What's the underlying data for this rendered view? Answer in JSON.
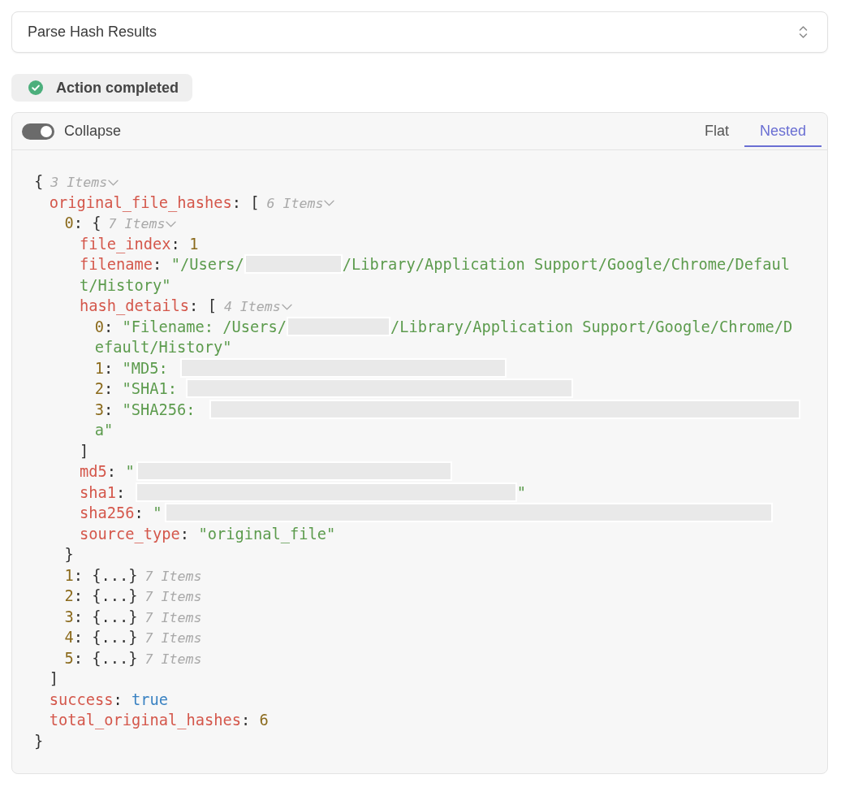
{
  "select": {
    "value": "Parse Hash Results"
  },
  "status": {
    "kind": "success",
    "text": "Action completed"
  },
  "viewer": {
    "collapse": {
      "label": "Collapse",
      "on": true
    },
    "tabs": [
      {
        "label": "Flat",
        "selected": false
      },
      {
        "label": "Nested",
        "selected": true
      }
    ],
    "tree": {
      "kind": "object",
      "open": "{",
      "count": "3 Items",
      "expanded": true,
      "close": "}",
      "children": [
        {
          "key": "original_file_hashes",
          "sep": ":",
          "kind": "array",
          "open": "[",
          "count": "6 Items",
          "expanded": true,
          "close": "]",
          "children": [
            {
              "key": "0",
              "sep": ":",
              "kind": "object",
              "open": "{",
              "count": "7 Items",
              "expanded": true,
              "close": "}",
              "children": [
                {
                  "key": "file_index",
                  "sep": ":",
                  "kind": "number",
                  "value": "1"
                },
                {
                  "key": "filename",
                  "sep": ":",
                  "kind": "string",
                  "parts": [
                    {
                      "kind": "text",
                      "text": "\"/Users/"
                    },
                    {
                      "kind": "redaction"
                    },
                    {
                      "kind": "text",
                      "text": "/Library/Application Support/Google/Chrome/Defaul"
                    },
                    {
                      "kind": "wrap"
                    },
                    {
                      "kind": "text",
                      "text": "t/History\""
                    }
                  ]
                },
                {
                  "key": "hash_details",
                  "sep": ":",
                  "kind": "array",
                  "open": "[",
                  "count": "4 Items",
                  "expanded": true,
                  "close": "]",
                  "children": [
                    {
                      "key": "0",
                      "sep": ":",
                      "kind": "string",
                      "parts": [
                        {
                          "kind": "text",
                          "text": "\"Filename: /Users/"
                        },
                        {
                          "kind": "redaction"
                        },
                        {
                          "kind": "text",
                          "text": "/Library/Application Support/Google/Chrome/D"
                        },
                        {
                          "kind": "wrap"
                        },
                        {
                          "kind": "text",
                          "text": "efault/History\""
                        }
                      ]
                    },
                    {
                      "key": "1",
                      "sep": ":",
                      "kind": "string",
                      "parts": [
                        {
                          "kind": "text",
                          "text": "\"MD5:"
                        },
                        {
                          "kind": "redaction"
                        }
                      ]
                    },
                    {
                      "key": "2",
                      "sep": ":",
                      "kind": "string",
                      "parts": [
                        {
                          "kind": "text",
                          "text": "\"SHA1:"
                        },
                        {
                          "kind": "redaction"
                        }
                      ]
                    },
                    {
                      "key": "3",
                      "sep": ":",
                      "kind": "string",
                      "parts": [
                        {
                          "kind": "text",
                          "text": "\"SHA256:"
                        },
                        {
                          "kind": "redaction"
                        },
                        {
                          "kind": "wrap"
                        },
                        {
                          "kind": "text",
                          "text": "a\""
                        }
                      ]
                    }
                  ]
                },
                {
                  "key": "md5",
                  "sep": ":",
                  "kind": "string",
                  "parts": [
                    {
                      "kind": "text",
                      "text": "\""
                    },
                    {
                      "kind": "redaction"
                    }
                  ]
                },
                {
                  "key": "sha1",
                  "sep": ":",
                  "kind": "string",
                  "parts": [
                    {
                      "kind": "redaction"
                    },
                    {
                      "kind": "text",
                      "text": "\""
                    }
                  ]
                },
                {
                  "key": "sha256",
                  "sep": ":",
                  "kind": "string",
                  "parts": [
                    {
                      "kind": "text",
                      "text": "\""
                    },
                    {
                      "kind": "redaction"
                    }
                  ]
                },
                {
                  "key": "source_type",
                  "sep": ":",
                  "kind": "string",
                  "value": "\"original_file\""
                }
              ]
            },
            {
              "key": "1",
              "sep": ":",
              "kind": "object",
              "summary": "{...}",
              "count": "7 Items",
              "expanded": false
            },
            {
              "key": "2",
              "sep": ":",
              "kind": "object",
              "summary": "{...}",
              "count": "7 Items",
              "expanded": false
            },
            {
              "key": "3",
              "sep": ":",
              "kind": "object",
              "summary": "{...}",
              "count": "7 Items",
              "expanded": false
            },
            {
              "key": "4",
              "sep": ":",
              "kind": "object",
              "summary": "{...}",
              "count": "7 Items",
              "expanded": false
            },
            {
              "key": "5",
              "sep": ":",
              "kind": "object",
              "summary": "{...}",
              "count": "7 Items",
              "expanded": false
            }
          ]
        },
        {
          "key": "success",
          "sep": ":",
          "kind": "boolean",
          "value": "true"
        },
        {
          "key": "total_original_hashes",
          "sep": ":",
          "kind": "number",
          "value": "6"
        }
      ]
    }
  }
}
